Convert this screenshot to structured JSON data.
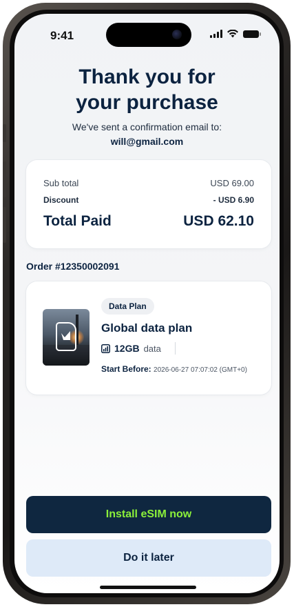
{
  "status": {
    "time": "9:41"
  },
  "header": {
    "title_line1": "Thank you for",
    "title_line2": "your purchase",
    "subtitle": "We've sent a confirmation email to:",
    "email": "will@gmail.com"
  },
  "summary": {
    "subtotal_label": "Sub total",
    "subtotal_value": "USD 69.00",
    "discount_label": "Discount",
    "discount_value": "- USD 6.90",
    "total_label": "Total Paid",
    "total_value": "USD 62.10"
  },
  "order": {
    "id": "Order #12350002091",
    "badge": "Data Plan",
    "plan_name": "Global data plan",
    "data_amount": "12GB",
    "data_unit": "data",
    "start_label": "Start Before:",
    "start_value": "2026-06-27 07:07:02 (GMT+0)"
  },
  "actions": {
    "primary": "Install eSIM now",
    "secondary": "Do it later"
  },
  "colors": {
    "navy": "#0c2340",
    "primary_bg": "#0f2740",
    "primary_text": "#8bf03a",
    "secondary_bg": "#deeaf8"
  },
  "icons": [
    "signal-icon",
    "wifi-icon",
    "battery-icon",
    "sim-card-icon",
    "data-bars-icon"
  ]
}
